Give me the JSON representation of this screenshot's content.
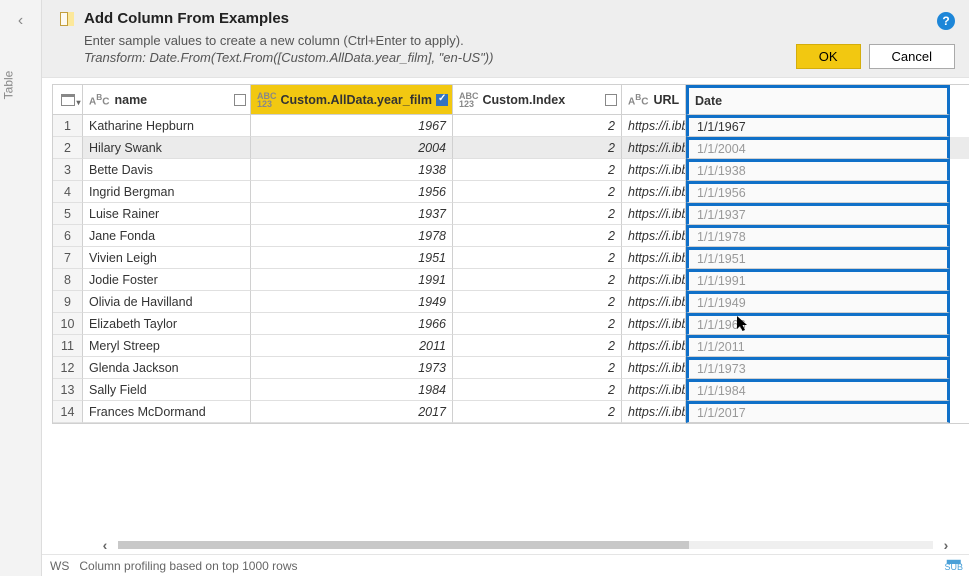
{
  "left": {
    "table_label": "Table"
  },
  "header": {
    "title": "Add Column From Examples",
    "subtitle": "Enter sample values to create a new column (Ctrl+Enter to apply).",
    "transform": "Transform: Date.From(Text.From([Custom.AllData.year_film], \"en-US\"))",
    "ok": "OK",
    "cancel": "Cancel"
  },
  "columns": {
    "name": "name",
    "year": "Custom.AllData.year_film",
    "index": "Custom.Index",
    "url": "URL",
    "date": "Date"
  },
  "rows": [
    {
      "n": "1",
      "name": "Katharine Hepburn",
      "year": "1967",
      "idx": "2",
      "url": "https://i.ibb",
      "date": "1/1/1967"
    },
    {
      "n": "2",
      "name": "Hilary Swank",
      "year": "2004",
      "idx": "2",
      "url": "https://i.ibb",
      "date": "1/1/2004"
    },
    {
      "n": "3",
      "name": "Bette Davis",
      "year": "1938",
      "idx": "2",
      "url": "https://i.ibb",
      "date": "1/1/1938"
    },
    {
      "n": "4",
      "name": "Ingrid Bergman",
      "year": "1956",
      "idx": "2",
      "url": "https://i.ibb",
      "date": "1/1/1956"
    },
    {
      "n": "5",
      "name": "Luise Rainer",
      "year": "1937",
      "idx": "2",
      "url": "https://i.ibb",
      "date": "1/1/1937"
    },
    {
      "n": "6",
      "name": "Jane Fonda",
      "year": "1978",
      "idx": "2",
      "url": "https://i.ibb",
      "date": "1/1/1978"
    },
    {
      "n": "7",
      "name": "Vivien Leigh",
      "year": "1951",
      "idx": "2",
      "url": "https://i.ibb",
      "date": "1/1/1951"
    },
    {
      "n": "8",
      "name": "Jodie Foster",
      "year": "1991",
      "idx": "2",
      "url": "https://i.ibb",
      "date": "1/1/1991"
    },
    {
      "n": "9",
      "name": "Olivia de Havilland",
      "year": "1949",
      "idx": "2",
      "url": "https://i.ibb",
      "date": "1/1/1949"
    },
    {
      "n": "10",
      "name": "Elizabeth Taylor",
      "year": "1966",
      "idx": "2",
      "url": "https://i.ibb",
      "date": "1/1/1966"
    },
    {
      "n": "11",
      "name": "Meryl Streep",
      "year": "2011",
      "idx": "2",
      "url": "https://i.ibb",
      "date": "1/1/2011"
    },
    {
      "n": "12",
      "name": "Glenda Jackson",
      "year": "1973",
      "idx": "2",
      "url": "https://i.ibb",
      "date": "1/1/1973"
    },
    {
      "n": "13",
      "name": "Sally Field",
      "year": "1984",
      "idx": "2",
      "url": "https://i.ibb",
      "date": "1/1/1984"
    },
    {
      "n": "14",
      "name": "Frances McDormand",
      "year": "2017",
      "idx": "2",
      "url": "https://i.ibb",
      "date": "1/1/2017"
    }
  ],
  "status": {
    "profiling": "Column profiling based on top 1000 rows",
    "ws_prefix": "WS",
    "sub_label": "SUB"
  }
}
